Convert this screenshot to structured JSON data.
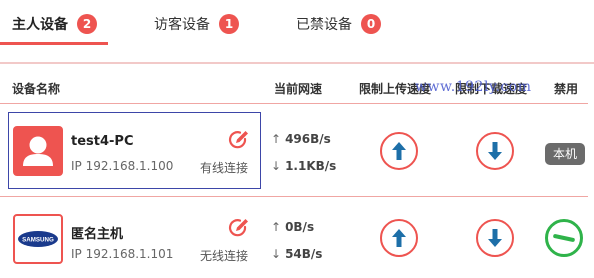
{
  "tabs": [
    {
      "label": "主人设备",
      "count": "2"
    },
    {
      "label": "访客设备",
      "count": "1"
    },
    {
      "label": "已禁设备",
      "count": "0"
    }
  ],
  "table": {
    "headers": {
      "device_name": "设备名称",
      "current_speed": "当前网速",
      "upload_limit": "限制上传速度",
      "download_limit": "限制下载速度",
      "block": "禁用"
    },
    "watermark": "www.192ly.com",
    "rows": [
      {
        "name": "test4-PC",
        "ip": "IP 192.168.1.100",
        "connection": "有线连接",
        "upload_speed": "496B/s",
        "download_speed": "1.1KB/s",
        "status_badge": "本机",
        "avatar_icon": "person-icon",
        "selected": true
      },
      {
        "name": "匿名主机",
        "ip": "IP 192.168.1.101",
        "connection": "无线连接",
        "upload_speed": "0B/s",
        "download_speed": "54B/s",
        "avatar_icon": "samsung-logo",
        "avatar_logo_text": "SAMSUNG",
        "block_state": "enabled"
      }
    ]
  },
  "icons": {
    "up_arrow": "↑",
    "down_arrow": "↓"
  },
  "colors": {
    "accent": "#ee5450",
    "arrow_blue": "#1d6fa8",
    "block_green": "#2fb34a",
    "selection_border": "#3d46a8",
    "badge_gray": "#6b6b6b"
  }
}
